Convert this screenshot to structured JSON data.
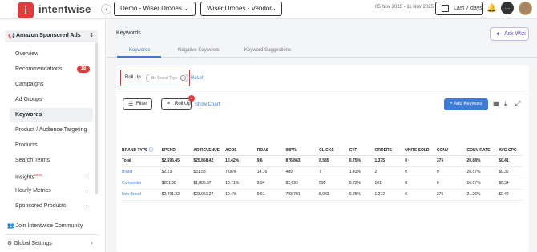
{
  "header": {
    "logo_letter": "i",
    "brand": "intentwise",
    "account_select": "Demo - Wiser Drones",
    "profile_select": "Wiser Drones - Vendor",
    "date_range": "05 Nov 2025 - 11 Nov 2025",
    "date_preset": "Last 7 days"
  },
  "sidebar": {
    "account_title": "Amazon Sponsored Ads",
    "items": [
      {
        "label": "Overview"
      },
      {
        "label": "Recommendations",
        "badge": "18"
      },
      {
        "label": "Campaigns"
      },
      {
        "label": "Ad Groups"
      },
      {
        "label": "Keywords"
      },
      {
        "label": "Product / Audience Targeting"
      },
      {
        "label": "Products"
      },
      {
        "label": "Search Terms"
      },
      {
        "label": "Insights",
        "tag": "NEW"
      },
      {
        "label": "Hourly Metrics"
      },
      {
        "label": "Sponsored Products"
      }
    ],
    "community": "Join Intentwise Community",
    "settings": "Global Settings"
  },
  "main": {
    "title": "Keywords",
    "ask_wizi": "Ask Wizi",
    "tabs": [
      "Keywords",
      "Negative Keywords",
      "Keyword Suggestions"
    ],
    "rollup_label": "Roll Up :",
    "rollup_chip": "By Brand Type",
    "reset": "Reset",
    "filter_btn": "Filter",
    "rollup_btn": "Roll Up",
    "show_chart": "Show Chart",
    "add_keyword": "+ Add Keyword"
  },
  "table": {
    "headers": [
      "BRAND TYPE",
      "SPEND",
      "AD REVENUE",
      "ACOS",
      "ROAS",
      "IMPR.",
      "CLICKS",
      "CTR",
      "ORDERS",
      "UNITS SOLD",
      "CONV",
      "CONV RATE",
      "AVG CPC"
    ],
    "rows": [
      [
        "Total",
        "$2,695.45",
        "$25,868.42",
        "10.42%",
        "9.6",
        "876,883",
        "6,585",
        "0.75%",
        "1,375",
        "0",
        "375",
        "20.88%",
        "$0.41"
      ],
      [
        "Brand",
        "$2.23",
        "$31.58",
        "7.06%",
        "14.16",
        "489",
        "7",
        "1.43%",
        "2",
        "0",
        "0",
        "28.57%",
        "$0.32"
      ],
      [
        "Competitor",
        "$201.90",
        "$1,885.57",
        "10.71%",
        "9.34",
        "82,693",
        "595",
        "0.72%",
        "101",
        "0",
        "0",
        "16.97%",
        "$0.34"
      ],
      [
        "Non Brand",
        "$2,491.32",
        "$23,951.27",
        "10.4%",
        "9.61",
        "793,701",
        "5,983",
        "0.75%",
        "1,272",
        "0",
        "375",
        "21.26%",
        "$0.42"
      ]
    ]
  },
  "colors": {
    "accent": "#3d7bd6",
    "brand_red": "#e23b3b"
  }
}
